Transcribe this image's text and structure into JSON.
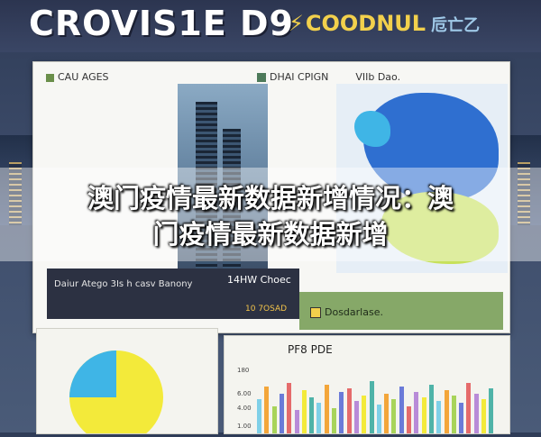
{
  "header": {
    "title": "CROVIS1",
    "title_suffix": "E D9",
    "accent_text": "COODNUL",
    "accent_tail": "卮亡乙"
  },
  "board": {
    "top_label": "CAU AGES",
    "map_header": "DHAI CPIGN",
    "map_subheader": "VIIb Dao."
  },
  "dark_panel": {
    "left_text": "Daiur Atego 3Is h casv Banony",
    "right_text": "14HW Choec",
    "small_text": "10 7OSAD"
  },
  "green_panel": {
    "label": "Dosdarlase."
  },
  "bar_card": {
    "title": "PF8 PDE",
    "ticks": [
      "180",
      "6.00",
      "4.00",
      "1.00"
    ]
  },
  "banner": {
    "text": "澳门疫情最新数据新增情况：澳\n门疫情最新数据新增"
  },
  "colors": {
    "pie_yellow": "#f3ea3a",
    "pie_cyan": "#3fb5e6",
    "map_blue": "#2f6fd0",
    "map_green": "#c7e15a"
  }
}
